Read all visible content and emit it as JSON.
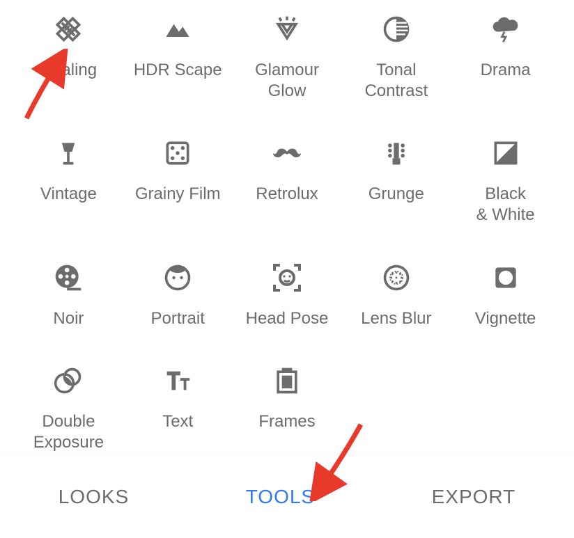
{
  "tools": [
    {
      "id": "healing",
      "label": "Healing",
      "icon": "bandage-icon"
    },
    {
      "id": "hdr-scape",
      "label": "HDR Scape",
      "icon": "mountains-icon"
    },
    {
      "id": "glamour-glow",
      "label": "Glamour\nGlow",
      "icon": "diamond-sparkle-icon"
    },
    {
      "id": "tonal-contrast",
      "label": "Tonal\nContrast",
      "icon": "half-circle-icon"
    },
    {
      "id": "drama",
      "label": "Drama",
      "icon": "storm-cloud-icon"
    },
    {
      "id": "vintage",
      "label": "Vintage",
      "icon": "lamp-icon"
    },
    {
      "id": "grainy-film",
      "label": "Grainy Film",
      "icon": "dice-icon"
    },
    {
      "id": "retrolux",
      "label": "Retrolux",
      "icon": "mustache-icon"
    },
    {
      "id": "grunge",
      "label": "Grunge",
      "icon": "guitar-head-icon"
    },
    {
      "id": "black-white",
      "label": "Black\n& White",
      "icon": "split-square-icon"
    },
    {
      "id": "noir",
      "label": "Noir",
      "icon": "film-reel-icon"
    },
    {
      "id": "portrait",
      "label": "Portrait",
      "icon": "face-outline-icon"
    },
    {
      "id": "head-pose",
      "label": "Head Pose",
      "icon": "face-detect-icon"
    },
    {
      "id": "lens-blur",
      "label": "Lens Blur",
      "icon": "blur-circle-icon"
    },
    {
      "id": "vignette",
      "label": "Vignette",
      "icon": "vignette-icon"
    },
    {
      "id": "double-exposure",
      "label": "Double\nExposure",
      "icon": "double-circle-icon"
    },
    {
      "id": "text",
      "label": "Text",
      "icon": "text-tt-icon"
    },
    {
      "id": "frames",
      "label": "Frames",
      "icon": "frame-icon"
    }
  ],
  "tabs": {
    "looks": "LOOKS",
    "tools": "TOOLS",
    "export": "EXPORT",
    "active": "tools"
  },
  "annotations": [
    {
      "target": "healing",
      "type": "arrow",
      "color": "#e83a2a"
    },
    {
      "target": "tools-tab",
      "type": "arrow",
      "color": "#e83a2a"
    }
  ]
}
